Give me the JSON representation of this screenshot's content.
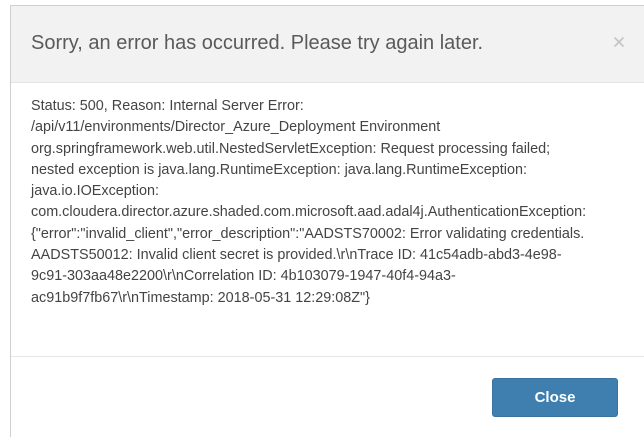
{
  "dialog": {
    "title": "Sorry, an error has occurred. Please try again later.",
    "close_icon": "close-icon",
    "message_lines": [
      "Status: 500, Reason: Internal Server Error:",
      "/api/v11/environments/Director_Azure_Deployment Environment",
      "org.springframework.web.util.NestedServletException: Request processing failed;",
      "nested exception is java.lang.RuntimeException: java.lang.RuntimeException:",
      "java.io.IOException:",
      "com.cloudera.director.azure.shaded.com.microsoft.aad.adal4j.AuthenticationException:",
      "{\"error\":\"invalid_client\",\"error_description\":\"AADSTS70002: Error validating credentials.",
      "AADSTS50012: Invalid client secret is provided.\\r\\nTrace ID: 41c54adb-abd3-4e98-",
      "9c91-303aa48e2200\\r\\nCorrelation ID: 4b103079-1947-40f4-94a3-",
      "ac91b9f7fb67\\r\\nTimestamp: 2018-05-31 12:29:08Z\"}"
    ],
    "close_button_label": "Close"
  },
  "colors": {
    "header_bg": "#f2f2f2",
    "button_bg": "#3f7fb0",
    "text": "#444444"
  }
}
